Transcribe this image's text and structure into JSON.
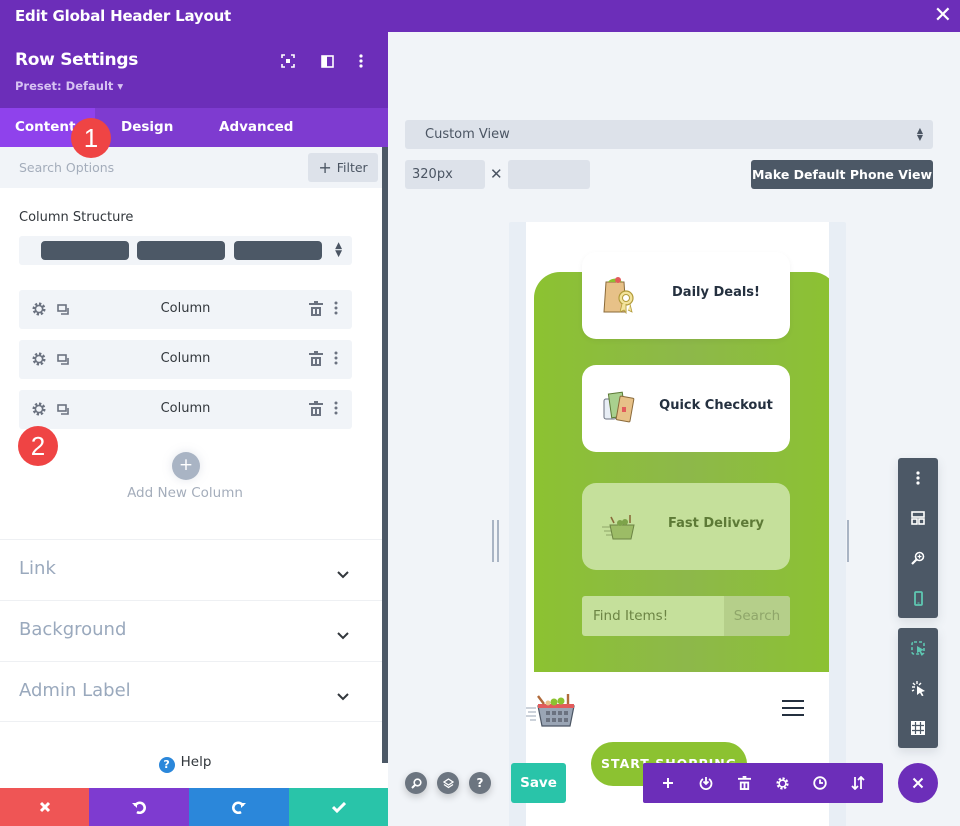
{
  "window": {
    "title": "Edit Global Header Layout",
    "close_icon": "close-icon"
  },
  "panel": {
    "title": "Row Settings",
    "preset": "Preset: Default ▾",
    "header_icons": [
      "expand-icon",
      "sidebar-layout-icon",
      "more-vertical-icon"
    ],
    "tabs": [
      {
        "label": "Content",
        "active": true
      },
      {
        "label": "Design",
        "active": false
      },
      {
        "label": "Advanced",
        "active": false
      }
    ],
    "search_placeholder": "Search Options",
    "filter_label": "Filter",
    "column_structure_label": "Column Structure",
    "column_structure_blocks": 3,
    "columns": [
      {
        "label": "Column"
      },
      {
        "label": "Column"
      },
      {
        "label": "Column"
      }
    ],
    "add_column_label": "Add New Column",
    "accordions": [
      {
        "label": "Link"
      },
      {
        "label": "Background"
      },
      {
        "label": "Admin Label"
      }
    ],
    "help_label": "Help",
    "footer": {
      "discard_color": "#ef5555",
      "undo_color": "#7e3bd0",
      "redo_color": "#2b87da",
      "save_color": "#29c4a9"
    }
  },
  "annotations": {
    "badge_1": "1",
    "badge_2": "2"
  },
  "preview": {
    "view_select": "Custom View",
    "width_value": "320px",
    "height_value": "",
    "times_symbol": "✕",
    "make_default_label": "Make Default Phone View",
    "cards": [
      {
        "label": "Daily Deals!",
        "icon": "shopping-bag-badge-icon"
      },
      {
        "label": "Quick Checkout",
        "icon": "payment-cards-icon"
      },
      {
        "label": "Fast Delivery",
        "icon": "fast-basket-icon"
      }
    ],
    "search_placeholder": "Find Items!",
    "search_button": "Search",
    "cta_label": "START SHOPPING",
    "accent_green": "#8cc231"
  },
  "bottom_bar": {
    "save_label": "Save",
    "round_buttons": [
      "search-icon",
      "layers-icon",
      "help-icon"
    ],
    "help_glyph": "?",
    "row_toolbar": [
      "add-icon",
      "portability-icon",
      "trash-icon",
      "gear-icon",
      "history-icon",
      "sort-icon"
    ]
  },
  "side_tools": {
    "group1": [
      "more-vertical-icon",
      "layout-icon",
      "zoom-icon",
      "phone-icon"
    ],
    "group2": [
      "select-icon",
      "click-icon",
      "grid-icon"
    ]
  }
}
